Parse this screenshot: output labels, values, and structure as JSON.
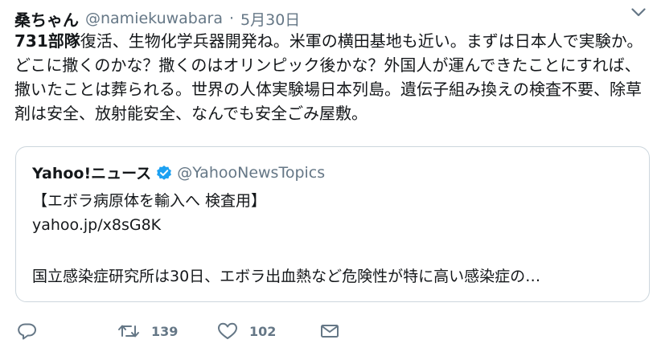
{
  "tweet": {
    "display_name": "桑ちゃん",
    "handle": "@namiekuwabara",
    "separator": "·",
    "date": "5月30日",
    "text_bold": "731部隊",
    "text_rest": "復活、生物化学兵器開発ね。米軍の横田基地も近い。まずは日本人で実験か。どこに撒くのかな？撒くのはオリンピック後かな？外国人が運んできたことにすれば、撒いたことは葬られる。世界の人体実験場日本列島。遺伝子組み換えの検査不要、除草剤は安全、放射能安全、なんでも安全ごみ屋敷。"
  },
  "quote": {
    "name": "Yahoo!ニュース",
    "handle": "@YahooNewsTopics",
    "headline": "【エボラ病原体を輸入へ 検査用】",
    "link": "yahoo.jp/x8sG8K",
    "summary": "国立感染症研究所は30日、エボラ出血熱など危険性が特に高い感染症の…"
  },
  "actions": {
    "retweet_count": "139",
    "like_count": "102"
  },
  "icons": {
    "menu": "chevron-down-icon",
    "verified": "verified-badge-icon",
    "reply": "reply-icon",
    "retweet": "retweet-icon",
    "like": "heart-icon",
    "dm": "envelope-icon"
  },
  "colors": {
    "text": "#14171a",
    "secondary": "#657786",
    "verified": "#1da1f2",
    "border": "#ccd6dd"
  }
}
